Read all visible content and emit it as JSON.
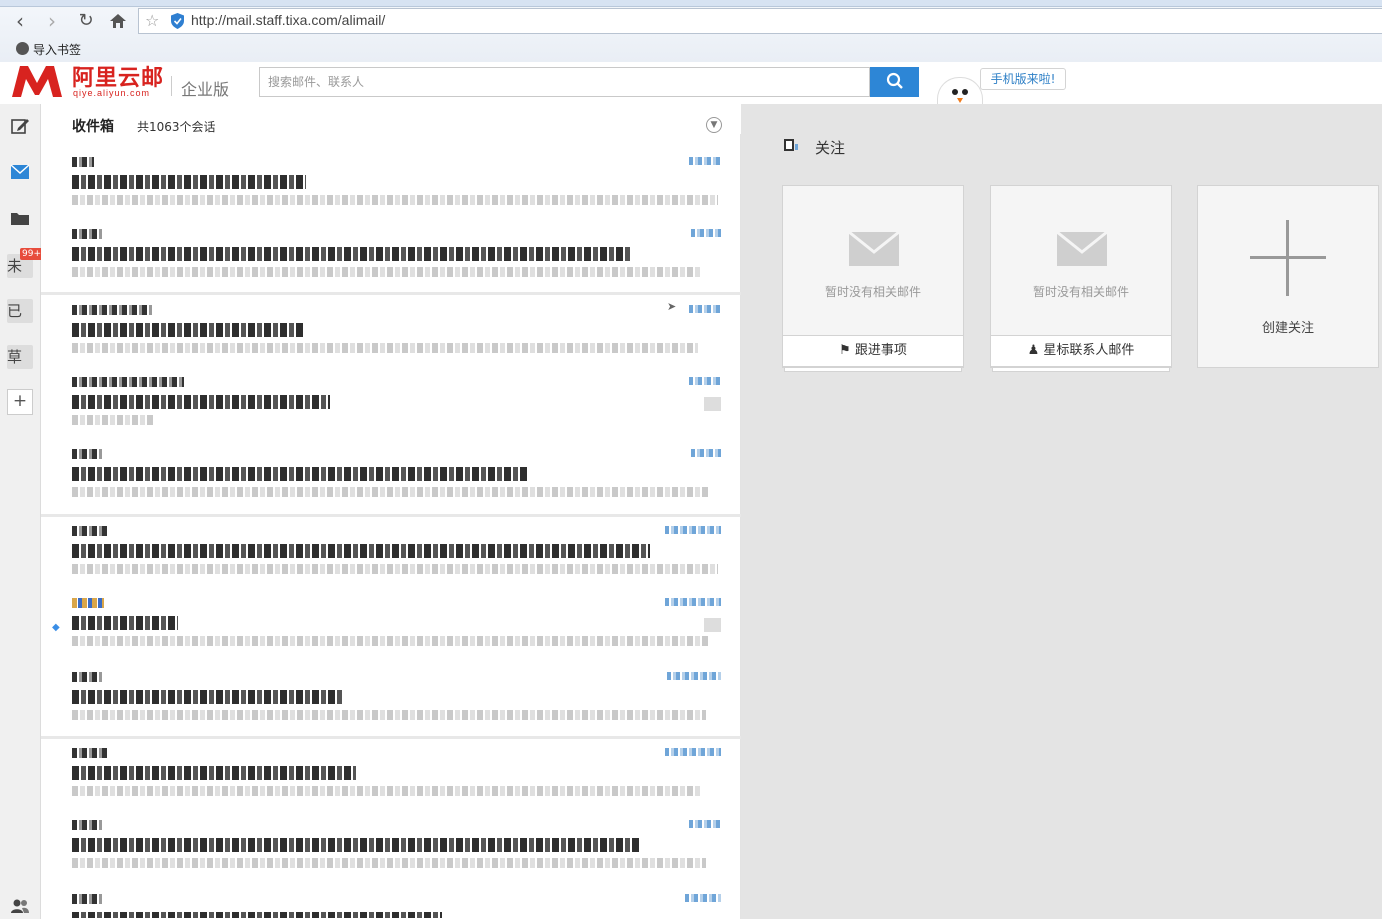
{
  "browser": {
    "url": "http://mail.staff.tixa.com/alimail/",
    "bookmark_label": "导入书签"
  },
  "header": {
    "logo_cn": "阿里云邮",
    "logo_en": "qiye.aliyun.com",
    "edition": "企业版",
    "search_placeholder": "搜索邮件、联系人",
    "mobile_bubble": "手机版来啦!"
  },
  "sidebar": {
    "items": [
      "compose",
      "inbox",
      "folders",
      "未",
      "已",
      "草",
      "add"
    ],
    "badge": "99+"
  },
  "mail_list": {
    "title": "收件箱",
    "count": "共1063个会话"
  },
  "focus": {
    "title": "关注",
    "cards": [
      {
        "empty_text": "暂时没有相关邮件",
        "footer_label": "跟进事项",
        "footer_icon": "flag-icon"
      },
      {
        "empty_text": "暂时没有相关邮件",
        "footer_label": "星标联系人邮件",
        "footer_icon": "person-icon"
      }
    ],
    "create_label": "创建关注"
  },
  "colors": {
    "brand_red": "#d8231f",
    "accent_blue": "#2d86d6"
  }
}
